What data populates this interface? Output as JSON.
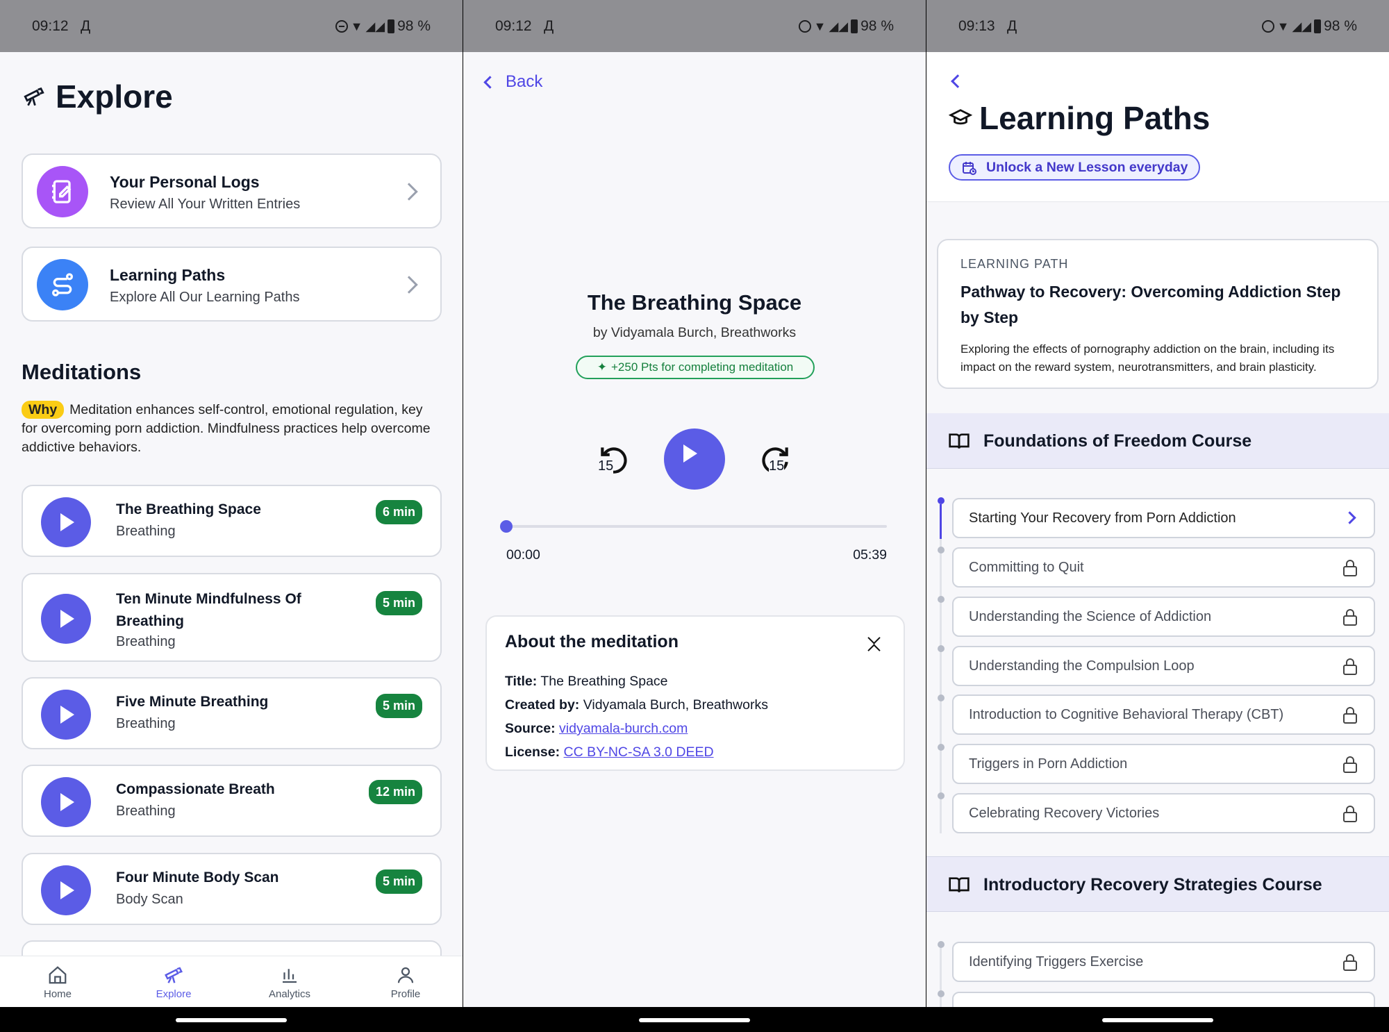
{
  "status": [
    {
      "time": "09:12",
      "carrier": "Д",
      "battery": "98 %"
    },
    {
      "time": "09:12",
      "carrier": "Д",
      "battery": "98 %"
    },
    {
      "time": "09:13",
      "carrier": "Д",
      "battery": "98 %"
    }
  ],
  "explore": {
    "title": "Explore",
    "cards": [
      {
        "title": "Your Personal Logs",
        "subtitle": "Review All Your Written Entries"
      },
      {
        "title": "Learning Paths",
        "subtitle": "Explore All Our Learning Paths"
      }
    ],
    "meditations_heading": "Meditations",
    "why_label": "Why",
    "why_text": "Meditation enhances self-control, emotional regulation, key for overcoming porn addiction. Mindfulness practices help overcome addictive behaviors.",
    "items": [
      {
        "title": "The Breathing Space",
        "category": "Breathing",
        "duration": "6 min"
      },
      {
        "title": "Ten Minute Mindfulness Of Breathing",
        "category": "Breathing",
        "duration": "5 min"
      },
      {
        "title": "Five Minute Breathing",
        "category": "Breathing",
        "duration": "5 min"
      },
      {
        "title": "Compassionate Breath",
        "category": "Breathing",
        "duration": "12 min"
      },
      {
        "title": "Four Minute Body Scan",
        "category": "Body Scan",
        "duration": "5 min"
      }
    ],
    "tabs": [
      "Home",
      "Explore",
      "Analytics",
      "Profile"
    ],
    "active_tab": "Explore",
    "accent": "#5b5ce6"
  },
  "player": {
    "back_label": "Back",
    "title": "The Breathing Space",
    "author": "by Vidyamala Burch, Breathworks",
    "points": "+250 Pts for completing meditation",
    "skip_back": "15",
    "skip_fwd": "15",
    "progress": 0.0,
    "elapsed": "00:00",
    "total": "05:39",
    "about": {
      "heading": "About the meditation",
      "rows": [
        {
          "label": "Title:",
          "value": "The Breathing Space"
        },
        {
          "label": "Created by:",
          "value": "Vidyamala Burch, Breathworks"
        },
        {
          "label": "Source:",
          "value": "vidyamala-burch.com"
        },
        {
          "label": "License:",
          "value": "CC BY-NC-SA 3.0 DEED"
        }
      ]
    }
  },
  "paths": {
    "title": "Learning Paths",
    "unlock": "Unlock a New Lesson everyday",
    "card": {
      "eyebrow": "LEARNING PATH",
      "title": "Pathway to Recovery: Overcoming Addiction Step by Step",
      "desc": "Exploring the effects of pornography addiction on the brain, including its impact on the reward system, neurotransmitters, and brain plasticity."
    },
    "course1": "Foundations of Freedom Course",
    "lessons1": [
      "Starting Your Recovery from Porn Addiction",
      "Committing to Quit",
      "Understanding the Science of Addiction",
      "Understanding the Compulsion Loop",
      "Introduction to Cognitive Behavioral Therapy (CBT)",
      "Triggers in Porn Addiction",
      "Celebrating Recovery Victories"
    ],
    "course2": "Introductory Recovery Strategies Course",
    "lessons2": [
      "Identifying Triggers Exercise"
    ]
  }
}
